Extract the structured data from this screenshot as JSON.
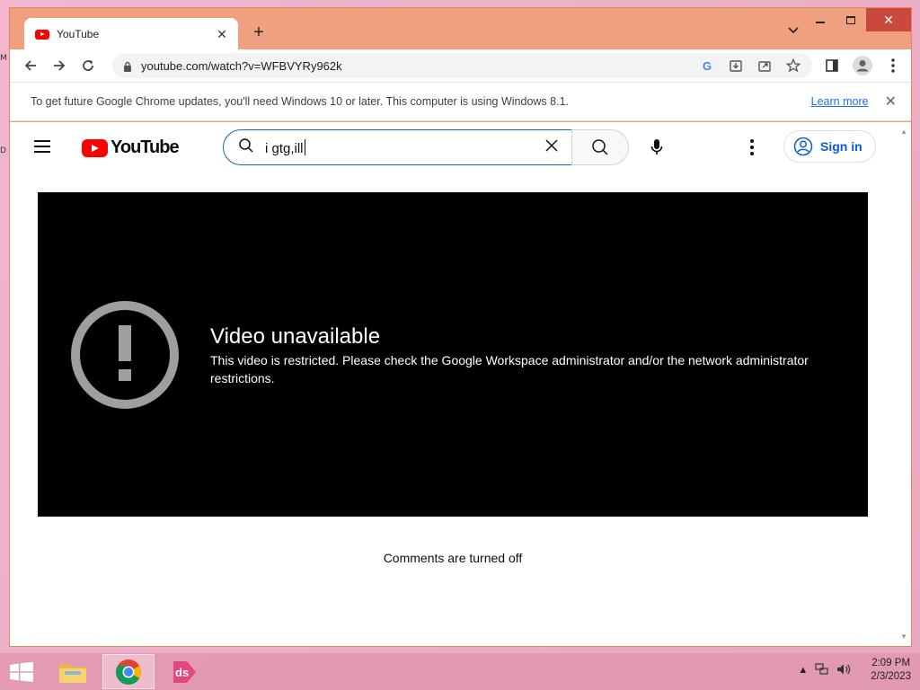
{
  "desktop": {
    "edge_label_top": "M",
    "edge_label_mid": "D"
  },
  "browser": {
    "tab_title": "YouTube",
    "new_tab_label": "+",
    "url": "youtube.com/watch?v=WFBVYRy962k",
    "infobar": {
      "message": "To get future Google Chrome updates, you'll need Windows 10 or later. This computer is using Windows 8.1.",
      "link": "Learn more"
    }
  },
  "youtube": {
    "logo_text": "YouTube",
    "search_query": "i gtg,ill",
    "sign_in": "Sign in",
    "player": {
      "title": "Video unavailable",
      "message": "This video is restricted. Please check the Google Workspace administrator and/or the network administrator restrictions."
    },
    "comments_status": "Comments are turned off"
  },
  "taskbar": {
    "time": "2:09 PM",
    "date": "2/3/2023",
    "apps": [
      "file-explorer",
      "chrome",
      "ds-app"
    ]
  },
  "colors": {
    "youtube_red": "#ff0000",
    "chrome_frame": "#f0a07e",
    "link_blue": "#1a73e8",
    "signin_blue": "#065fd4"
  }
}
